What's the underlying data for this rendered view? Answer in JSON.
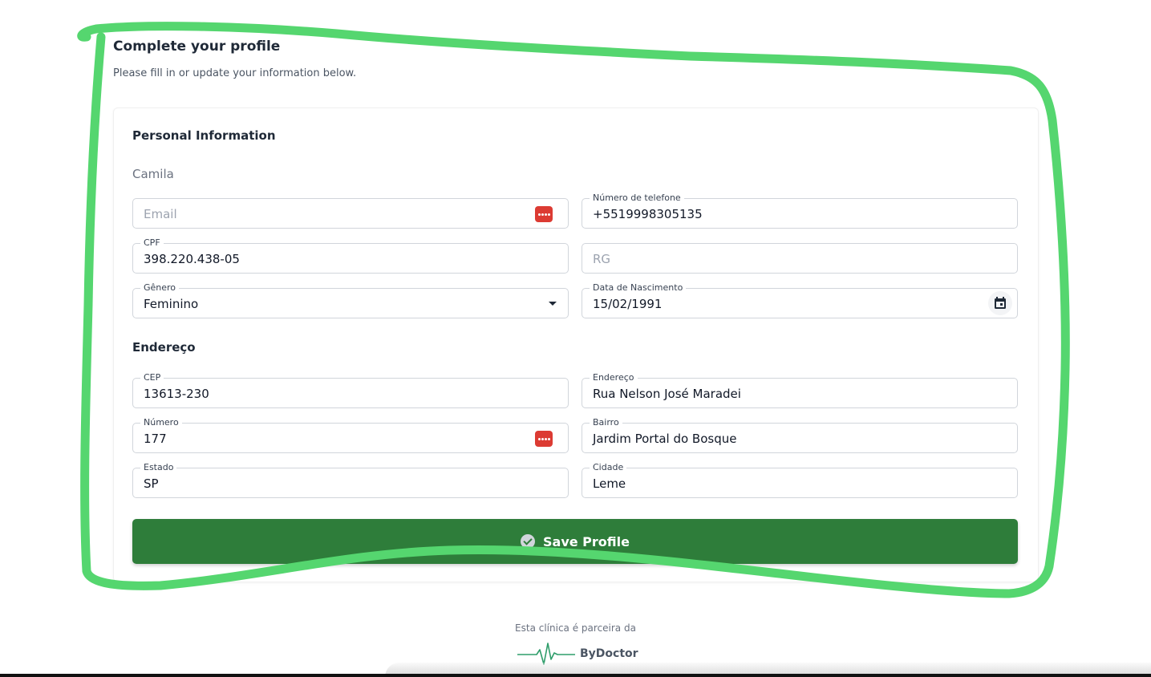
{
  "header": {
    "title": "Complete your profile",
    "subtitle": "Please fill in or update your information below."
  },
  "personal": {
    "section_title": "Personal Information",
    "name": "Camila",
    "email": {
      "placeholder": "Email",
      "value": ""
    },
    "telefone": {
      "label": "Número de telefone",
      "value": "+5519998305135"
    },
    "cpf": {
      "label": "CPF",
      "value": "398.220.438-05"
    },
    "rg": {
      "placeholder": "RG",
      "value": ""
    },
    "genero": {
      "label": "Gênero",
      "value": "Feminino"
    },
    "nascimento": {
      "label": "Data de Nascimento",
      "value": "15/02/1991"
    }
  },
  "address": {
    "section_title": "Endereço",
    "cep": {
      "label": "CEP",
      "value": "13613-230"
    },
    "endereco": {
      "label": "Endereço",
      "value": "Rua Nelson José Maradei"
    },
    "numero": {
      "label": "Número",
      "value": "177"
    },
    "bairro": {
      "label": "Bairro",
      "value": "Jardim Portal do Bosque"
    },
    "estado": {
      "label": "Estado",
      "value": "SP"
    },
    "cidade": {
      "label": "Cidade",
      "value": "Leme"
    }
  },
  "actions": {
    "save_label": "Save Profile"
  },
  "footer": {
    "partner_text": "Esta clínica é parceira da",
    "brand": "ByDoctor"
  },
  "colors": {
    "primary_button": "#2e7d3a",
    "highlight_stroke": "#55d66f",
    "password_icon": "#dc3b33",
    "logo_line": "#2e9d6a"
  },
  "icons": {
    "password_manager": "password-manager-icon",
    "dropdown": "chevron-down-icon",
    "calendar": "calendar-icon",
    "save": "check-circle-icon",
    "logo": "heartbeat-icon"
  }
}
